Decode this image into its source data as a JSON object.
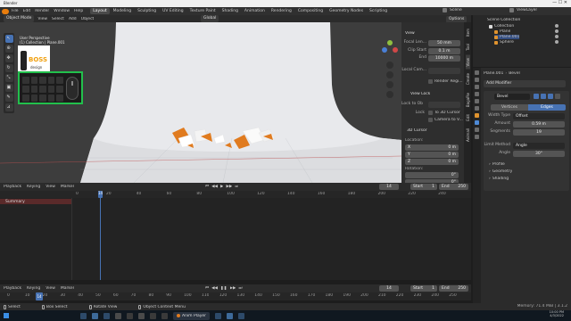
{
  "window_title": "Blender",
  "top_menu": [
    "File",
    "Edit",
    "Render",
    "Window",
    "Help"
  ],
  "workspaces": [
    "Layout",
    "Modeling",
    "Sculpting",
    "UV Editing",
    "Texture Paint",
    "Shading",
    "Animation",
    "Rendering",
    "Compositing",
    "Geometry Nodes",
    "Scripting"
  ],
  "active_workspace": "Layout",
  "scene_name": "Scene",
  "view_layer": "ViewLayer",
  "viewport_header": {
    "mode": "Object Mode",
    "menus": [
      "View",
      "Select",
      "Add",
      "Object"
    ],
    "transform": "Global",
    "options": "Options"
  },
  "viewport_info": {
    "view": "User Perspective",
    "object": "(1) Collection | Plane.001"
  },
  "overlay_logo_text": "BOSS",
  "overlay_logo_sub": "design",
  "npanel": {
    "view_header": "View",
    "focal_length_label": "Focal Len...",
    "focal_length": "50 mm",
    "clip_start_label": "Clip Start",
    "clip_start": "0.1 m",
    "end_label": "End",
    "end": "10000 m",
    "local_camera_label": "Local Cam...",
    "render_region": "Render Regi...",
    "view_lock_header": "View Lock",
    "lock_to_object": "Lock to Ob",
    "lock_label": "Lock",
    "to_3d_cursor": "To 3D Cursor",
    "camera_to_view": "Camera to V...",
    "cursor_header": "3D Cursor",
    "location_label": "Location:",
    "x": "X",
    "x_val": "0 m",
    "y": "Y",
    "y_val": "0 m",
    "z": "Z",
    "z_val": "0 m",
    "rotation_label": "Rotation:",
    "rx_val": "0°",
    "ry_val": "0°",
    "tabs": [
      "Item",
      "Tool",
      "View",
      "Create",
      "BagaPie",
      "Edit",
      "Animall"
    ]
  },
  "outliner": {
    "title": "Scene Collection",
    "items": [
      {
        "label": "Collection"
      },
      {
        "label": "Plane"
      },
      {
        "label": "Plane.001"
      },
      {
        "label": "Sphere"
      }
    ]
  },
  "properties": {
    "object_name": "Plane.001",
    "modifier_name": "Bevel",
    "add_modifier": "Add Modifier",
    "mod_label": "Bevel",
    "tab_vertices": "Vertices",
    "tab_edges": "Edges",
    "width_type_label": "Width Type",
    "width_type": "Offset",
    "amount_label": "Amount",
    "amount": "0.59 m",
    "segments_label": "Segments",
    "segments": "19",
    "limit_method_label": "Limit Method",
    "limit_method": "Angle",
    "angle_label": "Angle",
    "angle": "30°",
    "sections": [
      "Profile",
      "Geometry",
      "Shading"
    ]
  },
  "timeline_top": {
    "menus": [
      "Playback",
      "Keying",
      "View",
      "Marker"
    ],
    "current_frame": "14",
    "start_label": "Start",
    "start": "1",
    "end_label": "End",
    "end": "250",
    "ticks": [
      "0",
      "20",
      "40",
      "60",
      "80",
      "100",
      "120",
      "140",
      "160",
      "180",
      "200",
      "220",
      "240"
    ],
    "summary": "Summary"
  },
  "timeline_bottom": {
    "menus": [
      "Playback",
      "Keying",
      "View",
      "Marker"
    ],
    "current_frame": "14",
    "start_label": "Start",
    "start": "1",
    "end_label": "End",
    "end": "250",
    "ticks": [
      "0",
      "10",
      "20",
      "30",
      "40",
      "50",
      "60",
      "70",
      "80",
      "90",
      "100",
      "110",
      "120",
      "130",
      "140",
      "150",
      "160",
      "170",
      "180",
      "190",
      "200",
      "210",
      "220",
      "230",
      "240",
      "250"
    ]
  },
  "statusbar": {
    "items": [
      "Select",
      "Box Select",
      "Rotate View",
      "Object Context Menu"
    ],
    "memory": "Memory: 71.4 MiB | 3.1.2"
  },
  "taskbar": {
    "app_label": "Anim Player",
    "time": "10:00 PM",
    "date": "4/3/2022"
  },
  "colors": {
    "accent": "#4772b3",
    "playhead": "#4772b3",
    "orange": "#e07b1f"
  }
}
